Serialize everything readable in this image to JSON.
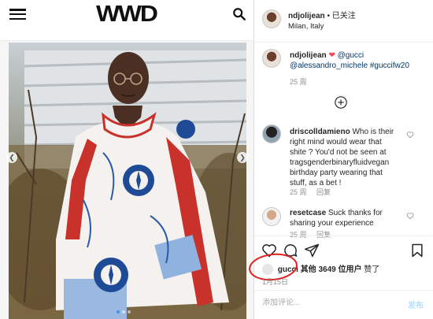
{
  "site": {
    "logo": "WWD",
    "menu_icon": "hamburger-icon",
    "search_icon": "search-icon"
  },
  "post": {
    "image": "photo-of-man-in-printed-jacket",
    "header": {
      "username": "ndjolijean",
      "separator": "•",
      "follow_label": "已关注",
      "location": "Milan, Italy"
    },
    "caption": {
      "username": "ndjolijean",
      "emoji": "❤",
      "mention_1": "@gucci",
      "mention_2": "@alessandro_michele",
      "hashtag": "#guccifw20",
      "time": "25 周"
    },
    "comments": [
      {
        "username": "driscolldamieno",
        "text": "Who is their right mind would wear that shite ? You'd not be seen at tragsgenderbinaryfluidvegan birthday party wearing that stuff, as a bet !",
        "time": "25 周",
        "reply_label": "回复"
      },
      {
        "username": "resetcase",
        "text": "Suck thanks for sharing your experience",
        "time": "25 周",
        "reply_label": "回复"
      }
    ],
    "likes": {
      "first_user": "gucci",
      "others_text": "其他 3649 位用户",
      "suffix": "赞了"
    },
    "date": "1月15日",
    "comment_input_placeholder": "添加评论...",
    "post_label": "发布"
  },
  "colors": {
    "link": "#00376b",
    "muted": "#8e8e8e",
    "highlight_circle": "#e02020",
    "post_disabled": "#b2dffc"
  }
}
